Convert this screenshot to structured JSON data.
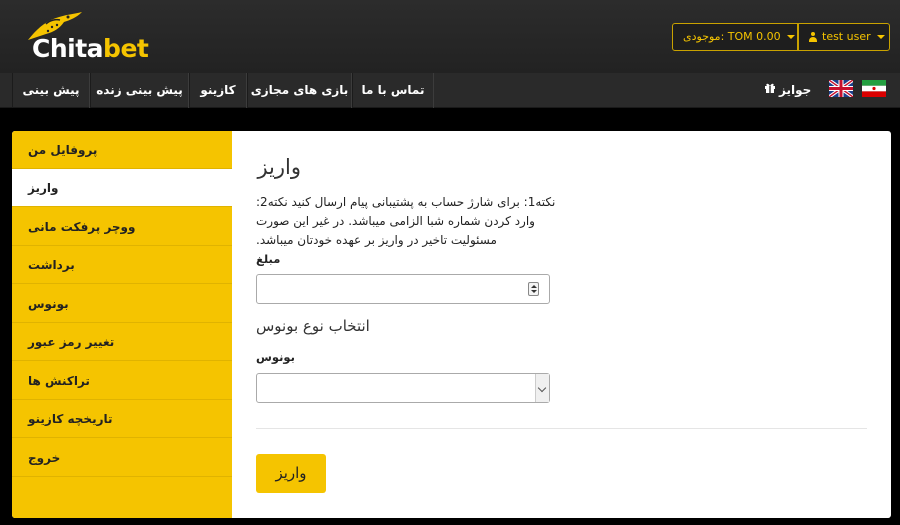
{
  "brand": {
    "name_part1": "Chita",
    "name_part2": "bet",
    "accent": "#f5c400"
  },
  "header": {
    "balance_label": "موجودی: TOM 0.00",
    "user_label": "test user"
  },
  "nav": {
    "items": [
      "پیش بینی",
      "پیش بینی زنده",
      "کازینو",
      "بازی های مجازی",
      "تماس با ما"
    ],
    "prizes_label": "جوایز",
    "flags": [
      "flag-uk-icon",
      "flag-iran-icon"
    ]
  },
  "sidebar": {
    "items": [
      {
        "label": "پروفایل من"
      },
      {
        "label": "واریز"
      },
      {
        "label": "ووچر پرفکت مانی"
      },
      {
        "label": "برداشت"
      },
      {
        "label": "بونوس"
      },
      {
        "label": "تغییر رمز عبور"
      },
      {
        "label": "تراکنش ها"
      },
      {
        "label": "تاریخچه کازینو"
      },
      {
        "label": "خروج"
      }
    ],
    "active_index": 1
  },
  "content": {
    "title": "واریز",
    "note_line1": "نکته1: برای شارژ حساب به پشتیبانی پیام ارسال کنید نکته2:",
    "note_line2": "وارد کردن شماره شبا الزامی میباشد. در غیر این صورت",
    "note_line3": "مسئولیت تاخیر در واریز بر عهده خودتان میباشد.",
    "amount_label": "مبلغ",
    "amount_value": "",
    "bonus_heading": "انتخاب نوع بونوس",
    "bonus_label": "بونوس",
    "bonus_selected": "",
    "submit_label": "واریز"
  }
}
